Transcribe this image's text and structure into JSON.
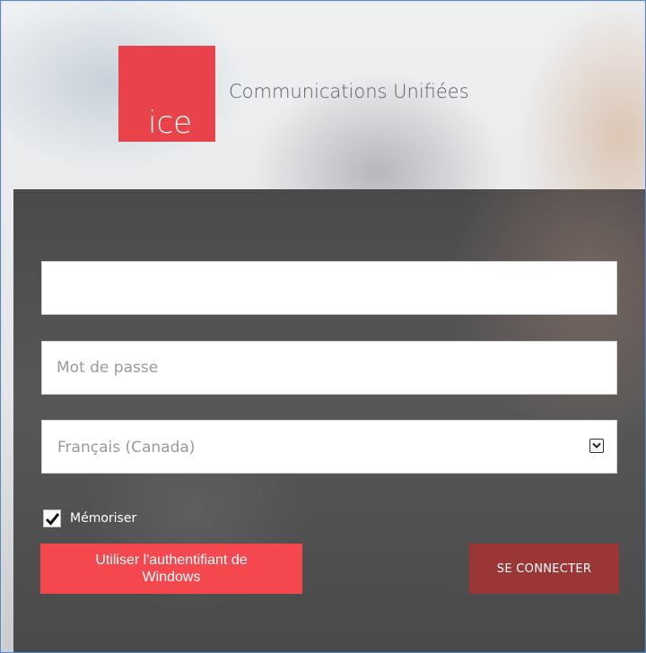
{
  "header": {
    "logo_text": "ice",
    "app_title": "Communications Unifiées"
  },
  "form": {
    "username": {
      "value": "",
      "placeholder": ""
    },
    "password": {
      "value": "",
      "placeholder": "Mot de passe"
    },
    "language": {
      "selected": "Français (Canada)"
    },
    "remember": {
      "label": "Mémoriser",
      "checked": true
    },
    "windows_auth_button": "Utiliser l'authentifiant de Windows",
    "connect_button": "SE CONNECTER"
  },
  "colors": {
    "brand_red": "#e8434a",
    "windows_button": "#f4474e",
    "connect_button": "#9b3637",
    "panel_dark": "#505050",
    "frame_border": "#5b86c4"
  },
  "icons": {
    "select_arrow": "chevron-down-icon",
    "checkbox_mark": "checkmark-icon"
  }
}
